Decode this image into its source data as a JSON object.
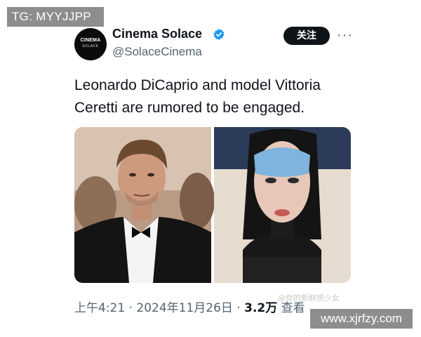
{
  "watermarks": {
    "top_left": "TG: MYYJJPP",
    "bottom_right": "www.xjrfzy.com",
    "faint_overlay": "@你的新鲜感少女"
  },
  "tweet": {
    "author": {
      "avatar_line1": "CINEMA",
      "avatar_line2": "SOLACE",
      "display_name": "Cinema Solace",
      "handle": "@SolaceCinema",
      "verified": true
    },
    "follow_label": "关注",
    "more_label": "···",
    "text": "Leonardo DiCaprio and model Vittoria Ceretti are rumored to be engaged.",
    "timestamp": "上午4:21 · 2024年11月26日 · ",
    "views_count": "3.2万",
    "views_label": " 查看"
  },
  "colors": {
    "verified_badge": "#1d9bf0",
    "follow_button_bg": "#0f1419",
    "secondary_text": "#536471"
  },
  "icons": [
    "verified-badge-icon",
    "more-options-icon"
  ]
}
